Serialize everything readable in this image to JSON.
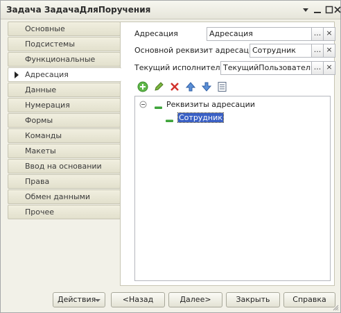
{
  "window": {
    "title": "Задача ЗадачаДляПоручения",
    "controls": [
      "menu-arrow-icon",
      "minimize-icon",
      "maximize-icon",
      "close-icon"
    ]
  },
  "nav": {
    "items": [
      {
        "label": "Основные",
        "active": false
      },
      {
        "label": "Подсистемы",
        "active": false
      },
      {
        "label": "Функциональные опции",
        "active": false
      },
      {
        "label": "Адресация",
        "active": true
      },
      {
        "label": "Данные",
        "active": false
      },
      {
        "label": "Нумерация",
        "active": false
      },
      {
        "label": "Формы",
        "active": false
      },
      {
        "label": "Команды",
        "active": false
      },
      {
        "label": "Макеты",
        "active": false
      },
      {
        "label": "Ввод на основании",
        "active": false
      },
      {
        "label": "Права",
        "active": false
      },
      {
        "label": "Обмен данными",
        "active": false
      },
      {
        "label": "Прочее",
        "active": false
      }
    ]
  },
  "form": {
    "addressing": {
      "label": "Адресация",
      "value": "Адресация",
      "select_label": "...",
      "clear_label": "×"
    },
    "main_attribute": {
      "label": "Основной реквизит адресации",
      "value": "Сотрудник",
      "select_label": "...",
      "clear_label": "×"
    },
    "performer": {
      "label": "Текущий исполнитель",
      "value": "ТекущийПользователь",
      "select_label": "...",
      "clear_label": "×"
    }
  },
  "toolbar": {
    "icons": [
      "add-icon",
      "edit-icon",
      "delete-icon",
      "move-up-icon",
      "move-down-icon",
      "list-icon"
    ]
  },
  "tree": {
    "root": {
      "label": "Реквизиты адресации",
      "expanded": true
    },
    "children": [
      {
        "label": "Сотрудник",
        "selected": true
      }
    ]
  },
  "footer": {
    "actions_label": "Действия",
    "back_label": "<Назад",
    "next_label": "Далее>",
    "close_label": "Закрыть",
    "help_label": "Справка"
  },
  "colors": {
    "selection": "#3a60c5",
    "window_bg": "#f2f1e8",
    "nav_bg": "#e2e0cd"
  }
}
